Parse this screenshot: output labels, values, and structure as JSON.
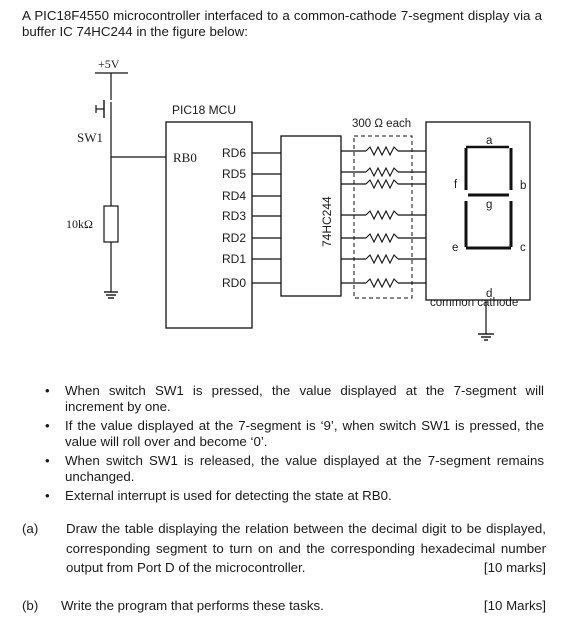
{
  "intro": "A PIC18F4550 microcontroller interfaced to a common-cathode 7-segment display via a buffer IC 74HC244 in the figure below:",
  "diagram": {
    "supply_label": "+5V",
    "switch_label": "SW1",
    "resistor_label": "10kΩ",
    "mcu_label": "PIC18 MCU",
    "mcu_input_pin": "RB0",
    "mcu_output_pins": [
      "RD6",
      "RD5",
      "RD4",
      "RD3",
      "RD2",
      "RD1",
      "RD0"
    ],
    "buffer_label": "74HC244",
    "resistor_array_label": "300 Ω each",
    "segment_pins": [
      "a",
      "b",
      "c",
      "d",
      "e",
      "f",
      "g"
    ],
    "display_segment_labels": {
      "a": "a",
      "b": "b",
      "c": "c",
      "d": "d",
      "e": "e",
      "f": "f",
      "g": "g"
    },
    "display_label": "common cathode"
  },
  "bullets": [
    "When switch SW1 is pressed, the value displayed at the 7-segment will increment by one.",
    "If the value displayed at the 7-segment is ‘9’, when switch SW1 is pressed, the value will roll over and become ‘0’.",
    "When switch SW1 is released, the value displayed at the 7-segment remains unchanged.",
    "External interrupt is used for detecting the state at RB0."
  ],
  "bullet_glyph": "•",
  "questions": [
    {
      "label": "(a)",
      "text": "Draw the table displaying the relation between the decimal digit to be displayed, corresponding segment to turn on and the corresponding hexadecimal number output from Port D of the microcontroller.",
      "marks": "[10 marks]"
    },
    {
      "label": "(b)",
      "text": "Write the program that performs these tasks.",
      "marks": "[10 Marks]"
    }
  ]
}
